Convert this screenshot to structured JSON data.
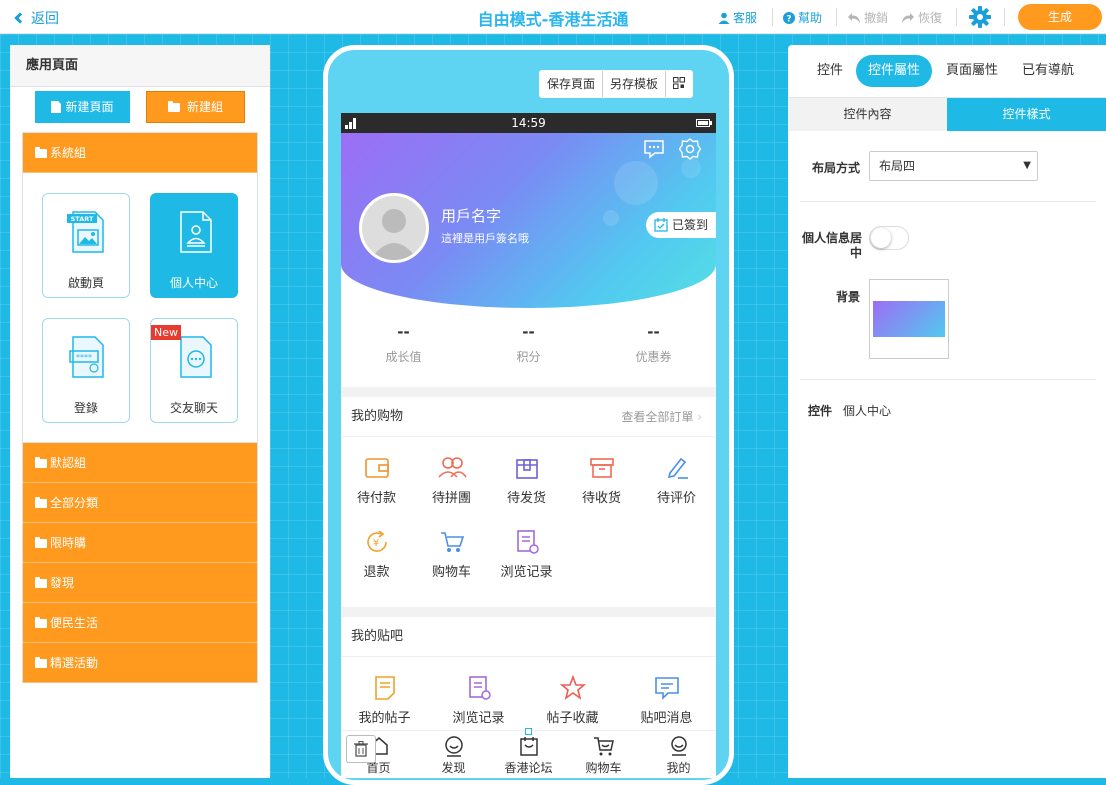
{
  "topbar": {
    "back": "返回",
    "title": "自由模式-香港生活通",
    "service": "客服",
    "help": "幫助",
    "undo": "撤銷",
    "redo": "恢復",
    "generate": "生成",
    "colors": {
      "accent": "#29b6f0",
      "orange": "#ff9a1e"
    }
  },
  "left": {
    "title": "應用頁面",
    "new_page": "新建頁面",
    "new_group": "新建組",
    "system_group": "系統組",
    "tiles": [
      {
        "label": "啟動頁",
        "badge": "START"
      },
      {
        "label": "個人中心"
      },
      {
        "label": "登錄"
      },
      {
        "label": "交友聊天",
        "badge": "New"
      }
    ],
    "groups": [
      "默認組",
      "全部分類",
      "限時購",
      "發現",
      "便民生活",
      "精選活動"
    ]
  },
  "phone": {
    "buttons": {
      "save": "保存頁面",
      "template": "另存模板",
      "qr": "qr-icon"
    },
    "time": "14:59",
    "user": {
      "name": "用戶名字",
      "signature": "這裡是用戶簽名哦",
      "signed": "已簽到"
    },
    "stats": [
      {
        "value": "--",
        "label": "成长值"
      },
      {
        "value": "--",
        "label": "积分"
      },
      {
        "value": "--",
        "label": "优惠券"
      }
    ],
    "shopping": {
      "title": "我的购物",
      "more": "查看全部訂單",
      "items": [
        "待付款",
        "待拼團",
        "待发货",
        "待收货",
        "待评价",
        "退款",
        "购物车",
        "浏览记录"
      ]
    },
    "forum": {
      "title": "我的贴吧",
      "items": [
        "我的帖子",
        "浏览记录",
        "帖子收藏",
        "贴吧消息"
      ]
    },
    "tabs": [
      "首页",
      "发现",
      "香港论坛",
      "购物车",
      "我的"
    ]
  },
  "right": {
    "tabs": [
      "控件",
      "控件屬性",
      "頁面屬性",
      "已有導航"
    ],
    "subtabs": [
      "控件內容",
      "控件樣式"
    ],
    "layout_label": "布局方式",
    "layout_value": "布局四",
    "center_label_1": "個人信息居",
    "center_label_2": "中",
    "center_on": false,
    "bg_label": "背景",
    "control_label": "控件",
    "control_value": "個人中心"
  }
}
